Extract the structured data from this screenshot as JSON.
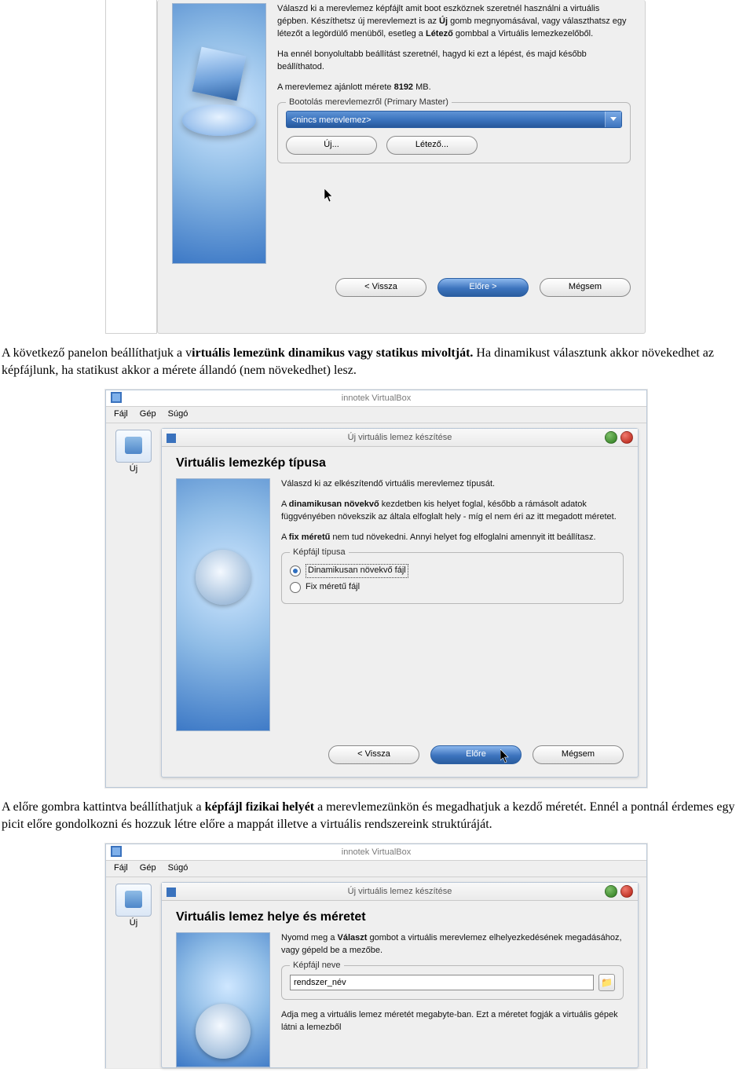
{
  "dialog1": {
    "para1_a": "Válaszd ki a merevlemez képfájlt amit boot eszköznek szeretnél használni a virtuális gépben. Készíthetsz új merevlemezt is az ",
    "para1_b": "Új",
    "para1_c": " gomb megnyomásával, vagy választhatsz egy létezőt a legördülő menüből, esetleg a ",
    "para1_d": "Létező",
    "para1_e": " gombbal a Virtuális lemezkezelőből.",
    "para2": "Ha ennél bonyolultabb beállítást szeretnél, hagyd ki ezt a lépést, és majd később beállíthatod.",
    "para3_a": "A merevlemez ajánlott mérete ",
    "para3_b": "8192",
    "para3_c": " MB.",
    "group_legend": "Bootolás merevlemezről (Primary Master)",
    "combo_value": "<nincs merevlemez>",
    "btn_new": "Új...",
    "btn_existing": "Létező...",
    "btn_back": "< Vissza",
    "btn_next": "Előre >",
    "btn_cancel": "Mégsem"
  },
  "doc_para1_a": "A következő panelon beállíthatjuk a v",
  "doc_para1_b": "irtuális lemezünk dinamikus vagy statikus mivoltját.",
  "doc_para1_c": " Ha dinamikust választunk akkor növekedhet az képfájlunk, ha statikust akkor a mérete állandó (nem növekedhet) lesz.",
  "app": {
    "title": "innotek VirtualBox",
    "menu_file": "Fájl",
    "menu_machine": "Gép",
    "menu_help": "Súgó",
    "toolbar_new": "Új"
  },
  "dialog2": {
    "title": "Új virtuális lemez készítése",
    "heading": "Virtuális lemezkép típusa",
    "para1": "Válaszd ki az elkészítendő virtuális merevlemez típusát.",
    "para2_a": "A ",
    "para2_b": "dinamikusan növekvő",
    "para2_c": " kezdetben kis helyet foglal, később a rámásolt adatok függvényében növekszik az általa elfoglalt hely - míg el nem éri az itt megadott méretet.",
    "para3_a": "A ",
    "para3_b": "fix méretű",
    "para3_c": " nem tud növekedni. Annyi helyet fog elfoglalni amennyit itt beállítasz.",
    "group_legend": "Képfájl típusa",
    "radio_dynamic": "Dinamikusan növekvő fájl",
    "radio_fixed": "Fix méretű fájl",
    "btn_back": "< Vissza",
    "btn_next": "Előre",
    "btn_cancel": "Mégsem"
  },
  "doc_para2_a": "A előre gombra kattintva beállíthatjuk a ",
  "doc_para2_b": "képfájl fizikai helyét",
  "doc_para2_c": " a merevlemezünkön és megadhatjuk a kezdő méretét. Ennél a pontnál érdemes egy picit előre gondolkozni és hozzuk létre előre a mappát illetve a virtuális rendszereink struktúráját.",
  "dialog3": {
    "title": "Új virtuális lemez készítése",
    "heading": "Virtuális lemez helye és méretet",
    "para1_a": "Nyomd meg a ",
    "para1_b": "Választ",
    "para1_c": " gombot a virtuális merevlemez elhelyezkedésének megadásához, vagy gépeld be a mezőbe.",
    "group_legend": "Képfájl neve",
    "input_value": "rendszer_név",
    "para2": "Adja meg a virtuális lemez méretét megabyte-ban. Ezt a méretet fogják a virtuális gépek látni a lemezből"
  }
}
